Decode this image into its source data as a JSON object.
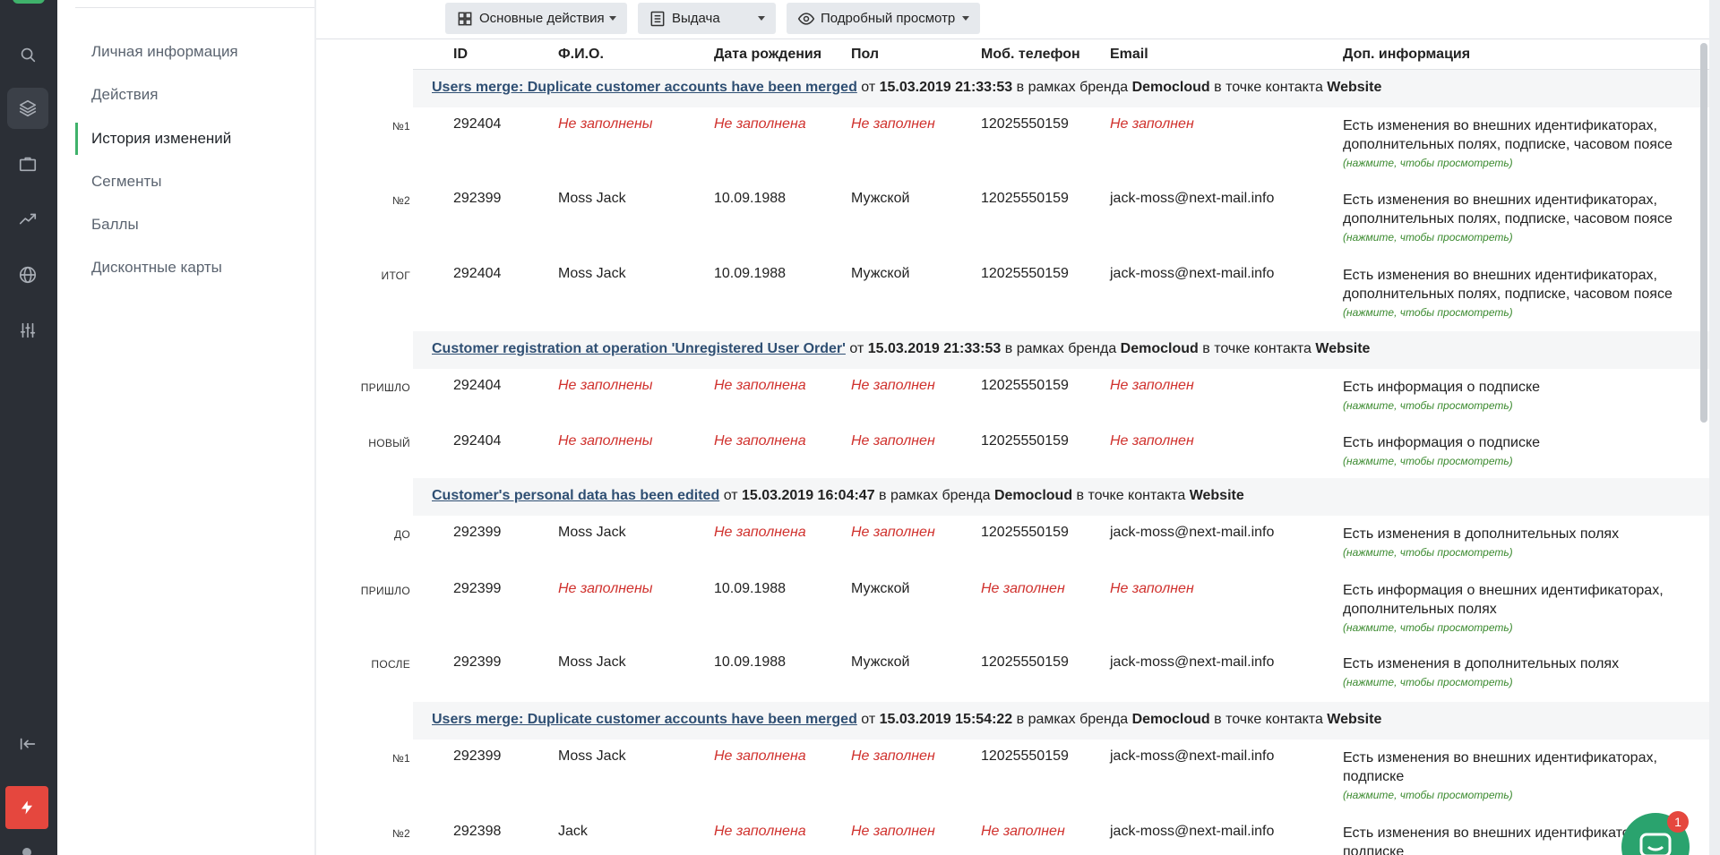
{
  "nav": {
    "items": [
      {
        "label": "Личная информация"
      },
      {
        "label": "Действия"
      },
      {
        "label": "История изменений",
        "active": true
      },
      {
        "label": "Сегменты"
      },
      {
        "label": "Баллы"
      },
      {
        "label": "Дисконтные карты"
      }
    ]
  },
  "toolbar": {
    "actions_label": "Основные действия",
    "output_label": "Выдача",
    "view_label": "Подробный просмотр"
  },
  "columns": {
    "id": "ID",
    "name": "Ф.И.О.",
    "birth": "Дата рождения",
    "gender": "Пол",
    "phone": "Моб. телефон",
    "email": "Email",
    "extra": "Доп. информация"
  },
  "events": [
    {
      "link": "Users merge: Duplicate customer accounts have been merged",
      "from_word": "от",
      "datetime": "15.03.2019 21:33:53",
      "brand_word": "в рамках бренда",
      "brand": "Democloud",
      "point_word": "в точке контакта",
      "point": "Website"
    },
    {
      "link": "Customer registration at operation 'Unregistered User Order'",
      "from_word": "от",
      "datetime": "15.03.2019 21:33:53",
      "brand_word": "в рамках бренда",
      "brand": "Democloud",
      "point_word": "в точке контакта",
      "point": "Website"
    },
    {
      "link": "Customer's personal data has been edited",
      "from_word": "от",
      "datetime": "15.03.2019 16:04:47",
      "brand_word": "в рамках бренда",
      "brand": "Democloud",
      "point_word": "в точке контакта",
      "point": "Website"
    },
    {
      "link": "Users merge: Duplicate customer accounts have been merged",
      "from_word": "от",
      "datetime": "15.03.2019 15:54:22",
      "brand_word": "в рамках бренда",
      "brand": "Democloud",
      "point_word": "в точке контакта",
      "point": "Website"
    }
  ],
  "rows": [
    {
      "label": "№1",
      "id": "292404",
      "name": "Не заполнены",
      "birth": "Не заполнена",
      "gender": "Не заполнен",
      "phone": "12025550159",
      "email": "Не заполнен",
      "info": "Есть изменения во внешних идентификаторах, дополнительных полях, подписке, часовом поясе",
      "hint": "(нажмите, чтобы просмотреть)"
    },
    {
      "label": "№2",
      "id": "292399",
      "name": "Moss Jack",
      "birth": "10.09.1988",
      "gender": "Мужской",
      "phone": "12025550159",
      "email": "jack-moss@next-mail.info",
      "info": "Есть изменения во внешних идентификаторах, дополнительных полях, подписке, часовом поясе",
      "hint": "(нажмите, чтобы просмотреть)"
    },
    {
      "label": "ИТОГ",
      "id": "292404",
      "name": "Moss Jack",
      "birth": "10.09.1988",
      "gender": "Мужской",
      "phone": "12025550159",
      "email": "jack-moss@next-mail.info",
      "info": "Есть изменения во внешних идентификаторах, дополнительных полях, подписке, часовом поясе",
      "hint": "(нажмите, чтобы просмотреть)"
    },
    {
      "label": "ПРИШЛО",
      "id": "292404",
      "name": "Не заполнены",
      "birth": "Не заполнена",
      "gender": "Не заполнен",
      "phone": "12025550159",
      "email": "Не заполнен",
      "info": "Есть информация о подписке",
      "hint": "(нажмите, чтобы просмотреть)"
    },
    {
      "label": "НОВЫЙ",
      "id": "292404",
      "name": "Не заполнены",
      "birth": "Не заполнена",
      "gender": "Не заполнен",
      "phone": "12025550159",
      "email": "Не заполнен",
      "info": "Есть информация о подписке",
      "hint": "(нажмите, чтобы просмотреть)"
    },
    {
      "label": "ДО",
      "id": "292399",
      "name": "Moss Jack",
      "birth": "Не заполнена",
      "gender": "Не заполнен",
      "phone": "12025550159",
      "email": "jack-moss@next-mail.info",
      "info": "Есть изменения в дополнительных полях",
      "hint": "(нажмите, чтобы просмотреть)"
    },
    {
      "label": "ПРИШЛО",
      "id": "292399",
      "name": "Не заполнены",
      "birth": "10.09.1988",
      "gender": "Мужской",
      "phone": "Не заполнен",
      "email": "Не заполнен",
      "info": "Есть информация о внешних идентификаторах, дополнительных полях",
      "hint": "(нажмите, чтобы просмотреть)"
    },
    {
      "label": "ПОСЛЕ",
      "id": "292399",
      "name": "Moss Jack",
      "birth": "10.09.1988",
      "gender": "Мужской",
      "phone": "12025550159",
      "email": "jack-moss@next-mail.info",
      "info": "Есть изменения в дополнительных полях",
      "hint": "(нажмите, чтобы просмотреть)"
    },
    {
      "label": "№1",
      "id": "292399",
      "name": "Moss Jack",
      "birth": "Не заполнена",
      "gender": "Не заполнен",
      "phone": "12025550159",
      "email": "jack-moss@next-mail.info",
      "info": "Есть изменения во внешних идентификаторах, подписке",
      "hint": "(нажмите, чтобы просмотреть)"
    },
    {
      "label": "№2",
      "id": "292398",
      "name": "Jack",
      "birth": "Не заполнена",
      "gender": "Не заполнен",
      "phone": "Не заполнен",
      "email": "jack-moss@next-mail.info",
      "info": "Есть изменения во внешних идентификаторах, подписке",
      "hint": ""
    }
  ],
  "chat": {
    "badge": "1"
  },
  "colors": {
    "accent": "#3fb26b",
    "empty": "#d0312d",
    "hint": "#3b8a2f",
    "link": "#2f4f73",
    "danger": "#e5473e"
  }
}
